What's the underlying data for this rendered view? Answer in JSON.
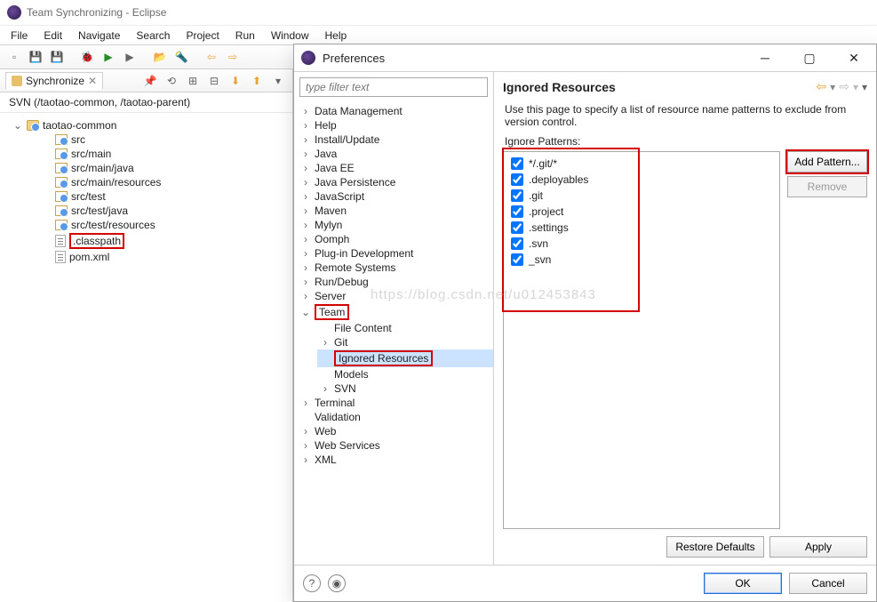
{
  "window": {
    "title": "Team Synchronizing - Eclipse"
  },
  "menus": [
    "File",
    "Edit",
    "Navigate",
    "Search",
    "Project",
    "Run",
    "Window",
    "Help"
  ],
  "sync": {
    "tab": "Synchronize",
    "svn": "SVN (/taotao-common, /taotao-parent)"
  },
  "project_tree": {
    "root": "taotao-common",
    "items": [
      "src",
      "src/main",
      "src/main/java",
      "src/main/resources",
      "src/test",
      "src/test/java",
      "src/test/resources",
      ".classpath",
      "pom.xml"
    ]
  },
  "prefs": {
    "title": "Preferences",
    "filter_placeholder": "type filter text",
    "nav": [
      {
        "label": "Data Management",
        "depth": 0,
        "exp": ">"
      },
      {
        "label": "Help",
        "depth": 0,
        "exp": ">"
      },
      {
        "label": "Install/Update",
        "depth": 0,
        "exp": ">"
      },
      {
        "label": "Java",
        "depth": 0,
        "exp": ">"
      },
      {
        "label": "Java EE",
        "depth": 0,
        "exp": ">"
      },
      {
        "label": "Java Persistence",
        "depth": 0,
        "exp": ">"
      },
      {
        "label": "JavaScript",
        "depth": 0,
        "exp": ">"
      },
      {
        "label": "Maven",
        "depth": 0,
        "exp": ">"
      },
      {
        "label": "Mylyn",
        "depth": 0,
        "exp": ">"
      },
      {
        "label": "Oomph",
        "depth": 0,
        "exp": ">"
      },
      {
        "label": "Plug-in Development",
        "depth": 0,
        "exp": ">"
      },
      {
        "label": "Remote Systems",
        "depth": 0,
        "exp": ">"
      },
      {
        "label": "Run/Debug",
        "depth": 0,
        "exp": ">"
      },
      {
        "label": "Server",
        "depth": 0,
        "exp": ">"
      },
      {
        "label": "Team",
        "depth": 0,
        "exp": "v",
        "red": true
      },
      {
        "label": "File Content",
        "depth": 1,
        "exp": ""
      },
      {
        "label": "Git",
        "depth": 1,
        "exp": ">"
      },
      {
        "label": "Ignored Resources",
        "depth": 1,
        "exp": "",
        "sel": true
      },
      {
        "label": "Models",
        "depth": 1,
        "exp": ""
      },
      {
        "label": "SVN",
        "depth": 1,
        "exp": ">"
      },
      {
        "label": "Terminal",
        "depth": 0,
        "exp": ">"
      },
      {
        "label": "Validation",
        "depth": 0,
        "exp": ""
      },
      {
        "label": "Web",
        "depth": 0,
        "exp": ">"
      },
      {
        "label": "Web Services",
        "depth": 0,
        "exp": ">"
      },
      {
        "label": "XML",
        "depth": 0,
        "exp": ">"
      }
    ],
    "page": {
      "heading": "Ignored Resources",
      "desc": "Use this page to specify a list of resource name patterns to exclude from version control.",
      "patterns_label": "Ignore Patterns:",
      "patterns": [
        "*/.git/*",
        ".deployables",
        ".git",
        ".project",
        ".settings",
        ".svn",
        "_svn"
      ],
      "add_btn": "Add Pattern...",
      "remove_btn": "Remove",
      "restore_btn": "Restore Defaults",
      "apply_btn": "Apply",
      "ok_btn": "OK",
      "cancel_btn": "Cancel"
    },
    "watermark": "https://blog.csdn.net/u012453843"
  }
}
